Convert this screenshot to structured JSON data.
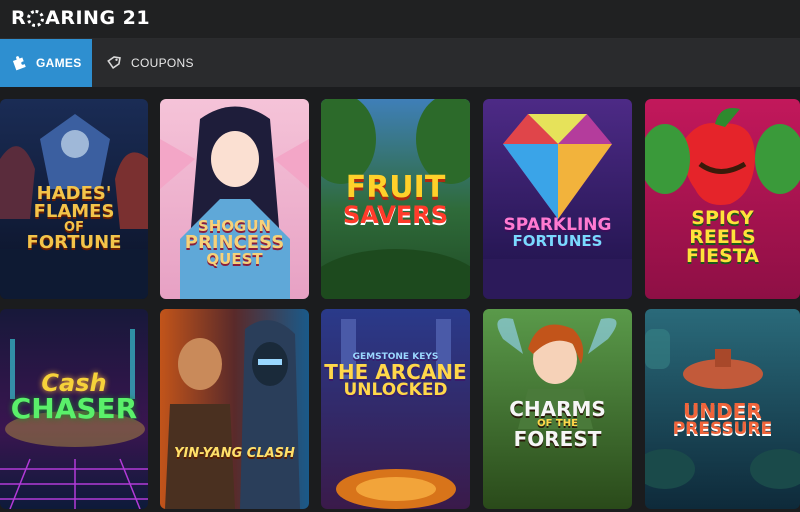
{
  "brand": {
    "logo_text_prefix": "R",
    "logo_text_suffix": "ARING 21"
  },
  "nav": {
    "tabs": [
      {
        "label": "GAMES",
        "icon": "games-puzzle-icon",
        "active": true
      },
      {
        "label": "COUPONS",
        "icon": "coupon-tag-icon",
        "active": false
      }
    ]
  },
  "games": [
    {
      "title_lines": [
        "HADES' FLAMES",
        "OF",
        "FORTUNE"
      ]
    },
    {
      "title_lines": [
        "SHOGUN",
        "PRINCESS",
        "QUEST"
      ]
    },
    {
      "title_lines": [
        "FRUIT",
        "SAVERS"
      ]
    },
    {
      "title_lines": [
        "SPARKLING",
        "FORTUNES"
      ]
    },
    {
      "title_lines": [
        "SPICY",
        "REELS",
        "FIESTA"
      ]
    },
    {
      "title_lines": [
        "Cash",
        "CHASER"
      ]
    },
    {
      "title_lines": [
        "YIN-YANG CLASH"
      ]
    },
    {
      "title_lines": [
        "GEMSTONE KEYS",
        "THE ARCANE",
        "UNLOCKED"
      ]
    },
    {
      "title_lines": [
        "CHARMS",
        "OF THE",
        "FOREST"
      ]
    },
    {
      "title_lines": [
        "UNDER",
        "PRESSURE"
      ]
    }
  ],
  "colors": {
    "accent": "#2e8fd0",
    "topbar": "#202122",
    "navbar": "#2a2b2d"
  }
}
